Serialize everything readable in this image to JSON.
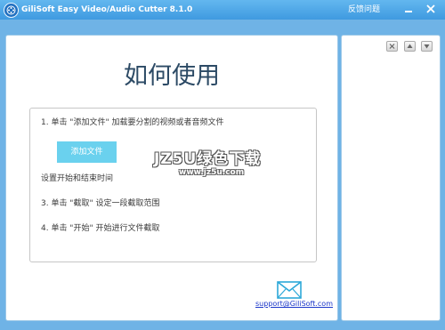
{
  "window": {
    "title": "GiliSoft Easy Video/Audio Cutter 8.1.0",
    "feedback_label": "反馈问题"
  },
  "main": {
    "howto_title": "如何使用",
    "steps": [
      "1. 单击 \"添加文件\" 加载要分割的视频或者音频文件",
      "设置开始和结束时间",
      "3. 单击 \"截取\" 设定一段截取范围",
      "4. 单击 \"开始\" 开始进行文件截取"
    ],
    "add_file_button": "添加文件",
    "support_email": "support@GiliSoft.com"
  },
  "watermark": {
    "line1": "JZ5U绿色下载",
    "line2": "www.jz5u.com"
  },
  "icons": {
    "app": "film-reel-icon",
    "minimize": "minimize-icon",
    "close": "close-icon",
    "side_close": "close-icon",
    "side_up": "chevron-up-icon",
    "side_down": "chevron-down-icon",
    "mail": "mail-envelope-icon"
  },
  "colors": {
    "titlebar": "#4aa7e8",
    "add_file_button": "#6ad1ee",
    "link": "#1a36c9"
  }
}
